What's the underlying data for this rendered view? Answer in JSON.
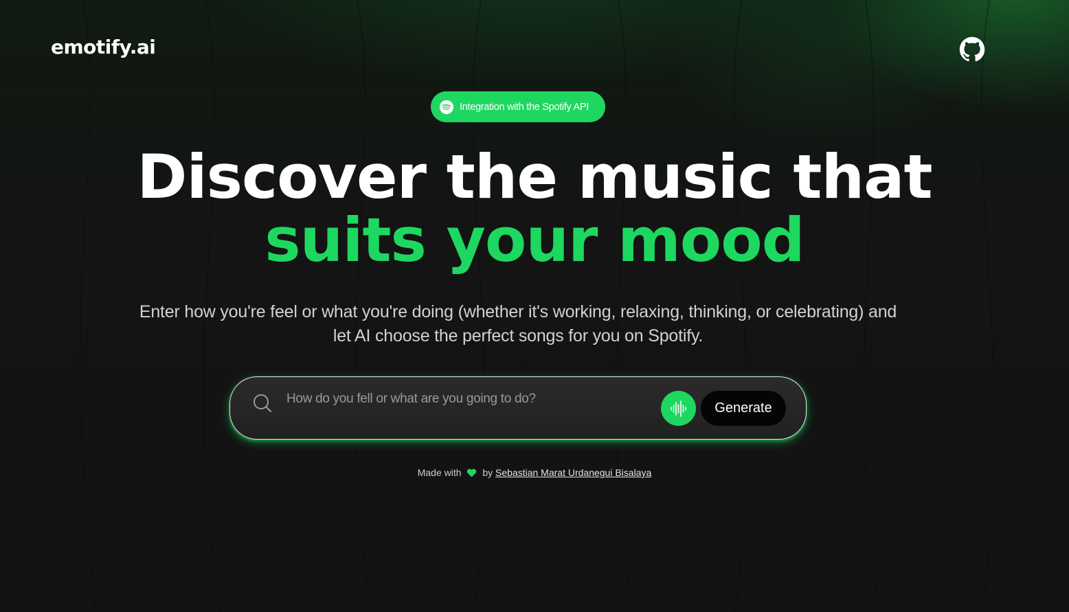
{
  "header": {
    "logo_text": "emotify.ai",
    "github_icon": "github-icon"
  },
  "badge": {
    "icon": "spotify-icon",
    "label": "Integration with the Spotify API"
  },
  "hero": {
    "headline_line1": "Discover the music that",
    "headline_line2": "suits your mood",
    "description": "Enter how you're feel or what you're doing (whether it's working, relaxing, thinking, or celebrating) and let AI choose the perfect songs for you on Spotify."
  },
  "search": {
    "icon": "search-icon",
    "placeholder": "How do you fell or what are you going to do?",
    "value": "",
    "voice_icon": "waveform-icon",
    "generate_label": "Generate"
  },
  "footer": {
    "made_with": "Made with",
    "heart_icon": "heart-icon",
    "by": "by",
    "author": "Sebastian Marat Urdanegui Bisalaya"
  },
  "colors": {
    "accent": "#1ed760",
    "background": "#121212",
    "text": "#ffffff",
    "subtext": "#d2d2d2"
  }
}
